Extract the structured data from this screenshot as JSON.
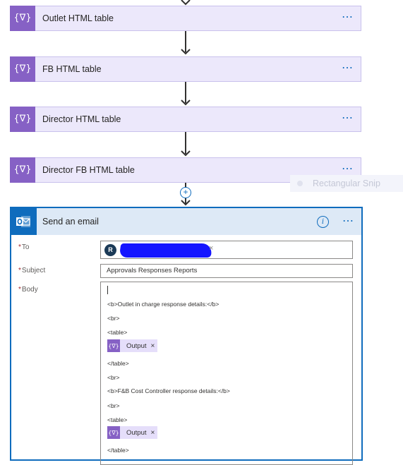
{
  "flow": {
    "actions": [
      {
        "title": "Outlet HTML table",
        "icon": "variable-icon"
      },
      {
        "title": "FB HTML table",
        "icon": "variable-icon"
      },
      {
        "title": "Director HTML table",
        "icon": "variable-icon"
      },
      {
        "title": "Director FB HTML table",
        "icon": "variable-icon"
      }
    ],
    "more_label": "⋯",
    "action_icon_glyph": "{∇}"
  },
  "ghost_tooltip": {
    "label": "Rectangular Snip"
  },
  "add_step": {
    "glyph": "+"
  },
  "email": {
    "title": "Send an email",
    "info_glyph": "i",
    "more_label": "⋯",
    "fields": {
      "to_label": "To",
      "subject_label": "Subject",
      "body_label": "Body",
      "required_mark": "*"
    },
    "to": {
      "avatar_initial": "R",
      "remove_glyph": "×"
    },
    "subject_value": "Approvals Responses Reports",
    "body_lines": [
      "<b>Outlet in charge response details:</b>",
      "<br>",
      "<table>",
      "</table>",
      "<br>",
      "<b>F&B Cost Controller response details:</b>",
      "<br>",
      "<table>",
      "</table>"
    ],
    "tokens": [
      {
        "label": "Output",
        "remove": "×",
        "glyph": "{∇}"
      },
      {
        "label": "Output",
        "remove": "×",
        "glyph": "{∇}"
      }
    ]
  },
  "colors": {
    "accent": "#0f6cbd",
    "action_purple": "#8661c5",
    "action_bg": "#ece8fb",
    "header_bg": "#dde9f6"
  }
}
